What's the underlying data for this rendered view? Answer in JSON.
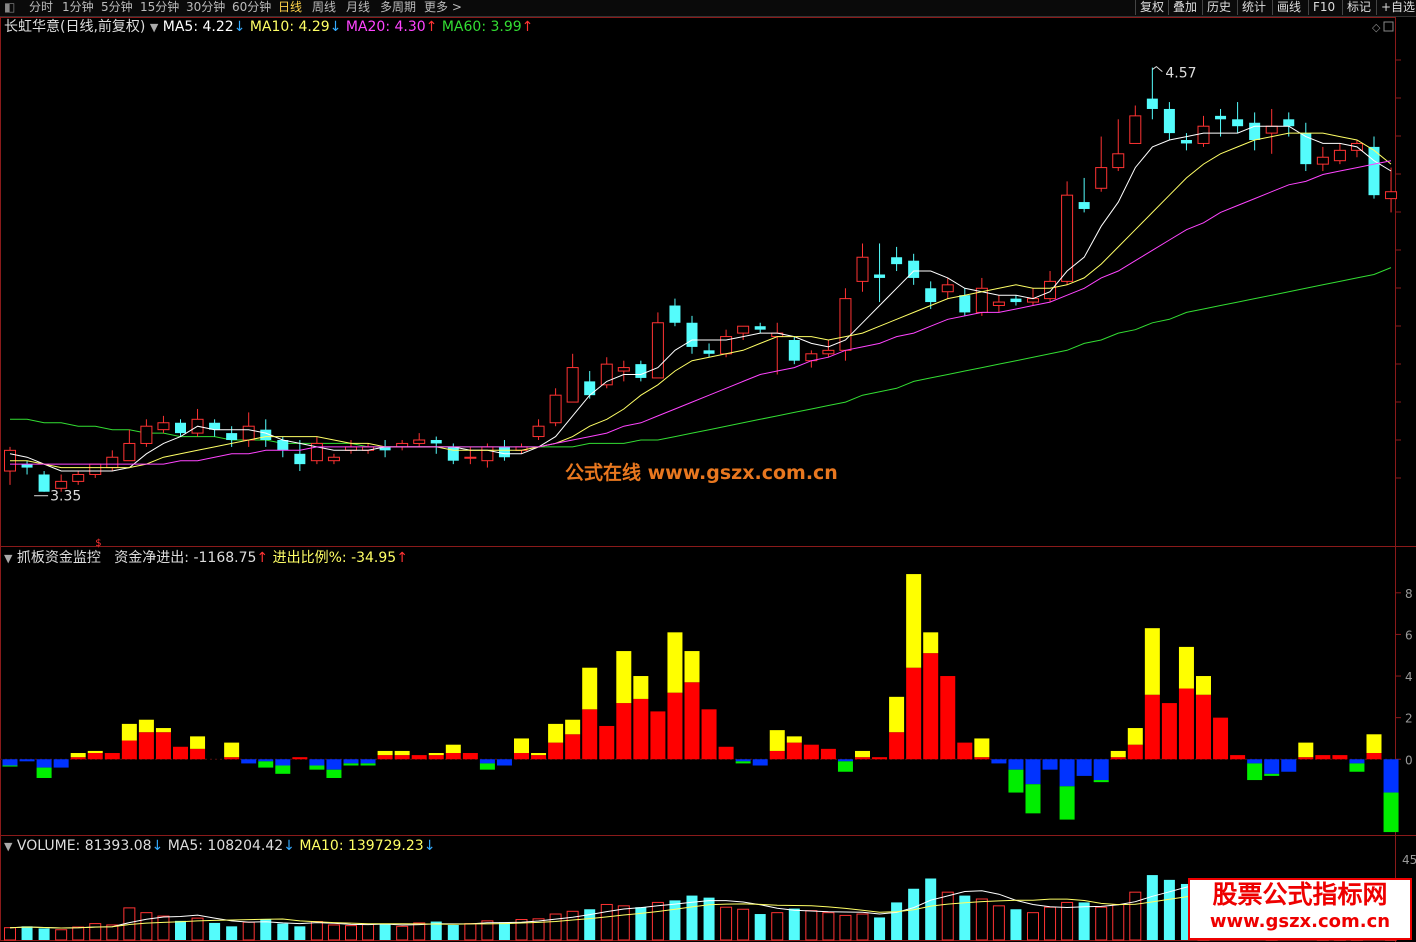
{
  "toolbar": {
    "periods": [
      "分时",
      "1分钟",
      "5分钟",
      "15分钟",
      "30分钟",
      "60分钟",
      "日线",
      "周线",
      "月线",
      "多周期",
      "更多 >"
    ],
    "active_period": "日线",
    "tools": [
      "复权",
      "叠加",
      "历史",
      "统计",
      "画线",
      "F10",
      "标记",
      "+自选"
    ]
  },
  "main_panel": {
    "stock_title": "长虹华意(日线,前复权)",
    "indicators": [
      {
        "label": "MA5: 4.22",
        "arrow": "↓",
        "color": "#ffffff"
      },
      {
        "label": "MA10: 4.29",
        "arrow": "↓",
        "color": "#ffff66"
      },
      {
        "label": "MA20: 4.30",
        "arrow": "↑",
        "color": "#ff44ff"
      },
      {
        "label": "MA60: 3.99",
        "arrow": "↑",
        "color": "#33dd33"
      }
    ],
    "high_label": "4.57",
    "low_label": "3.35",
    "watermark": "公式在线  www.gszx.com.cn"
  },
  "fund_panel": {
    "title": "抓板资金监控",
    "net_label": "资金净进出: -1168.75",
    "net_arrow": "↑",
    "ratio_label": "进出比例%: -34.95",
    "ratio_arrow": "↑",
    "y_ticks": [
      "8",
      "6",
      "4",
      "2",
      "0"
    ]
  },
  "volume_panel": {
    "label": "VOLUME: 81393.08",
    "label_arrow": "↓",
    "ma5": "MA5: 108204.42",
    "ma5_arrow": "↓",
    "ma10": "MA10: 139729.23",
    "ma10_arrow": "↓",
    "y_tick": "45"
  },
  "corner_watermark": {
    "line1": "股票公式指标网",
    "line2": "www.gszx.com.cn"
  },
  "colors": {
    "up": "#ff3333",
    "down": "#54fcfc",
    "ma5": "#ffffff",
    "ma10": "#ffff66",
    "ma20": "#ff44ff",
    "ma60": "#33dd33",
    "fund_red": "#ff0000",
    "fund_yellow": "#ffff00",
    "fund_blue": "#0033ff",
    "fund_green": "#00ee00"
  },
  "chart_data": {
    "type": "candlestick",
    "price_range": [
      3.2,
      4.65
    ],
    "candles": [
      [
        3.4,
        3.46,
        3.47,
        3.36
      ],
      [
        3.42,
        3.41,
        3.43,
        3.39
      ],
      [
        3.39,
        3.34,
        3.4,
        3.34
      ],
      [
        3.35,
        3.37,
        3.39,
        3.34
      ],
      [
        3.37,
        3.39,
        3.4,
        3.36
      ],
      [
        3.39,
        3.42,
        3.42,
        3.38
      ],
      [
        3.41,
        3.44,
        3.46,
        3.4
      ],
      [
        3.43,
        3.48,
        3.52,
        3.43
      ],
      [
        3.48,
        3.53,
        3.55,
        3.47
      ],
      [
        3.52,
        3.54,
        3.56,
        3.51
      ],
      [
        3.54,
        3.51,
        3.55,
        3.5
      ],
      [
        3.51,
        3.55,
        3.58,
        3.5
      ],
      [
        3.54,
        3.52,
        3.55,
        3.5
      ],
      [
        3.51,
        3.49,
        3.53,
        3.47
      ],
      [
        3.49,
        3.53,
        3.57,
        3.47
      ],
      [
        3.52,
        3.49,
        3.55,
        3.47
      ],
      [
        3.49,
        3.46,
        3.5,
        3.44
      ],
      [
        3.45,
        3.42,
        3.49,
        3.4
      ],
      [
        3.43,
        3.48,
        3.5,
        3.42
      ],
      [
        3.43,
        3.44,
        3.45,
        3.42
      ],
      [
        3.46,
        3.47,
        3.49,
        3.45
      ],
      [
        3.46,
        3.47,
        3.48,
        3.45
      ],
      [
        3.47,
        3.46,
        3.49,
        3.44
      ],
      [
        3.47,
        3.48,
        3.49,
        3.46
      ],
      [
        3.48,
        3.49,
        3.51,
        3.47
      ],
      [
        3.49,
        3.48,
        3.5,
        3.45
      ],
      [
        3.47,
        3.43,
        3.48,
        3.42
      ],
      [
        3.44,
        3.44,
        3.47,
        3.42
      ],
      [
        3.43,
        3.47,
        3.48,
        3.41
      ],
      [
        3.47,
        3.44,
        3.49,
        3.43
      ],
      [
        3.46,
        3.47,
        3.48,
        3.45
      ],
      [
        3.5,
        3.53,
        3.55,
        3.49
      ],
      [
        3.54,
        3.62,
        3.64,
        3.53
      ],
      [
        3.6,
        3.7,
        3.74,
        3.6
      ],
      [
        3.66,
        3.62,
        3.69,
        3.61
      ],
      [
        3.65,
        3.71,
        3.73,
        3.64
      ],
      [
        3.69,
        3.7,
        3.72,
        3.66
      ],
      [
        3.71,
        3.67,
        3.72,
        3.66
      ],
      [
        3.67,
        3.83,
        3.86,
        3.67
      ],
      [
        3.88,
        3.83,
        3.9,
        3.82
      ],
      [
        3.83,
        3.76,
        3.85,
        3.74
      ],
      [
        3.75,
        3.74,
        3.77,
        3.73
      ],
      [
        3.74,
        3.79,
        3.81,
        3.73
      ],
      [
        3.8,
        3.82,
        3.82,
        3.78
      ],
      [
        3.82,
        3.81,
        3.83,
        3.8
      ],
      [
        3.79,
        3.8,
        3.83,
        3.68
      ],
      [
        3.78,
        3.72,
        3.79,
        3.71
      ],
      [
        3.72,
        3.74,
        3.75,
        3.7
      ],
      [
        3.74,
        3.75,
        3.78,
        3.73
      ],
      [
        3.75,
        3.9,
        3.93,
        3.72
      ],
      [
        3.95,
        4.02,
        4.06,
        3.92
      ],
      [
        3.97,
        3.96,
        4.06,
        3.89
      ],
      [
        4.02,
        4.0,
        4.05,
        3.98
      ],
      [
        4.01,
        3.96,
        4.03,
        3.94
      ],
      [
        3.93,
        3.89,
        3.95,
        3.87
      ],
      [
        3.92,
        3.94,
        3.96,
        3.9
      ],
      [
        3.91,
        3.86,
        3.93,
        3.85
      ],
      [
        3.86,
        3.93,
        3.96,
        3.85
      ],
      [
        3.88,
        3.89,
        3.91,
        3.86
      ],
      [
        3.9,
        3.89,
        3.91,
        3.88
      ],
      [
        3.89,
        3.9,
        3.93,
        3.88
      ],
      [
        3.9,
        3.95,
        3.98,
        3.89
      ],
      [
        3.95,
        4.2,
        4.24,
        3.94
      ],
      [
        4.18,
        4.16,
        4.25,
        4.15
      ],
      [
        4.22,
        4.28,
        4.37,
        4.21
      ],
      [
        4.28,
        4.32,
        4.42,
        4.27
      ],
      [
        4.35,
        4.43,
        4.46,
        4.35
      ],
      [
        4.48,
        4.45,
        4.57,
        4.42
      ],
      [
        4.45,
        4.38,
        4.47,
        4.36
      ],
      [
        4.36,
        4.35,
        4.38,
        4.33
      ],
      [
        4.35,
        4.4,
        4.43,
        4.34
      ],
      [
        4.43,
        4.42,
        4.45,
        4.37
      ],
      [
        4.42,
        4.4,
        4.47,
        4.38
      ],
      [
        4.41,
        4.36,
        4.44,
        4.33
      ],
      [
        4.38,
        4.4,
        4.45,
        4.32
      ],
      [
        4.42,
        4.4,
        4.44,
        4.37
      ],
      [
        4.38,
        4.29,
        4.41,
        4.27
      ],
      [
        4.29,
        4.31,
        4.34,
        4.27
      ],
      [
        4.3,
        4.33,
        4.35,
        4.29
      ],
      [
        4.33,
        4.35,
        4.36,
        4.31
      ],
      [
        4.34,
        4.2,
        4.37,
        4.19
      ],
      [
        4.19,
        4.21,
        4.28,
        4.15
      ]
    ],
    "ma_series": [
      {
        "name": "MA5",
        "values": [
          3.45,
          3.44,
          3.42,
          3.4,
          3.4,
          3.4,
          3.4,
          3.41,
          3.45,
          3.48,
          3.5,
          3.53,
          3.52,
          3.52,
          3.52,
          3.51,
          3.49,
          3.48,
          3.47,
          3.46,
          3.46,
          3.46,
          3.47,
          3.47,
          3.47,
          3.47,
          3.47,
          3.46,
          3.46,
          3.45,
          3.45,
          3.47,
          3.5,
          3.56,
          3.62,
          3.66,
          3.68,
          3.68,
          3.7,
          3.75,
          3.78,
          3.78,
          3.78,
          3.79,
          3.8,
          3.8,
          3.79,
          3.77,
          3.76,
          3.78,
          3.83,
          3.88,
          3.93,
          3.98,
          3.98,
          3.96,
          3.93,
          3.92,
          3.91,
          3.91,
          3.9,
          3.92,
          3.98,
          4.02,
          4.11,
          4.18,
          4.28,
          4.34,
          4.36,
          4.37,
          4.38,
          4.38,
          4.38,
          4.4,
          4.4,
          4.4,
          4.37,
          4.35,
          4.35,
          4.34,
          4.3,
          4.27
        ]
      },
      {
        "name": "MA10",
        "values": [
          3.43,
          3.43,
          3.42,
          3.41,
          3.41,
          3.41,
          3.41,
          3.41,
          3.42,
          3.44,
          3.45,
          3.46,
          3.47,
          3.48,
          3.49,
          3.5,
          3.5,
          3.5,
          3.5,
          3.49,
          3.48,
          3.48,
          3.47,
          3.47,
          3.47,
          3.47,
          3.46,
          3.46,
          3.46,
          3.46,
          3.46,
          3.47,
          3.48,
          3.5,
          3.53,
          3.55,
          3.58,
          3.62,
          3.65,
          3.69,
          3.72,
          3.73,
          3.74,
          3.75,
          3.77,
          3.79,
          3.79,
          3.79,
          3.78,
          3.79,
          3.8,
          3.82,
          3.84,
          3.86,
          3.88,
          3.9,
          3.91,
          3.92,
          3.93,
          3.94,
          3.93,
          3.93,
          3.94,
          3.96,
          4.0,
          4.05,
          4.1,
          4.15,
          4.2,
          4.25,
          4.29,
          4.32,
          4.34,
          4.36,
          4.37,
          4.38,
          4.38,
          4.38,
          4.37,
          4.36,
          4.33,
          4.29
        ]
      },
      {
        "name": "MA20",
        "values": [
          3.42,
          3.42,
          3.42,
          3.42,
          3.42,
          3.42,
          3.42,
          3.42,
          3.42,
          3.42,
          3.43,
          3.43,
          3.44,
          3.45,
          3.45,
          3.46,
          3.46,
          3.46,
          3.47,
          3.47,
          3.47,
          3.47,
          3.47,
          3.47,
          3.47,
          3.47,
          3.47,
          3.47,
          3.47,
          3.47,
          3.47,
          3.47,
          3.48,
          3.49,
          3.5,
          3.51,
          3.53,
          3.54,
          3.56,
          3.58,
          3.6,
          3.62,
          3.64,
          3.66,
          3.68,
          3.69,
          3.7,
          3.72,
          3.73,
          3.75,
          3.76,
          3.77,
          3.79,
          3.8,
          3.82,
          3.84,
          3.85,
          3.86,
          3.86,
          3.87,
          3.88,
          3.89,
          3.91,
          3.93,
          3.96,
          3.98,
          4.01,
          4.04,
          4.07,
          4.1,
          4.12,
          4.15,
          4.17,
          4.19,
          4.21,
          4.23,
          4.24,
          4.26,
          4.27,
          4.28,
          4.29,
          4.3
        ]
      },
      {
        "name": "MA60",
        "values": [
          3.55,
          3.55,
          3.54,
          3.54,
          3.53,
          3.53,
          3.52,
          3.52,
          3.51,
          3.51,
          3.5,
          3.5,
          3.5,
          3.49,
          3.49,
          3.49,
          3.48,
          3.48,
          3.48,
          3.48,
          3.48,
          3.47,
          3.47,
          3.47,
          3.47,
          3.47,
          3.47,
          3.47,
          3.47,
          3.47,
          3.47,
          3.47,
          3.47,
          3.47,
          3.48,
          3.48,
          3.48,
          3.49,
          3.49,
          3.5,
          3.51,
          3.52,
          3.53,
          3.54,
          3.55,
          3.56,
          3.57,
          3.58,
          3.59,
          3.6,
          3.62,
          3.63,
          3.64,
          3.66,
          3.67,
          3.68,
          3.69,
          3.7,
          3.71,
          3.72,
          3.73,
          3.74,
          3.75,
          3.77,
          3.78,
          3.8,
          3.81,
          3.83,
          3.84,
          3.86,
          3.87,
          3.88,
          3.89,
          3.9,
          3.91,
          3.92,
          3.93,
          3.94,
          3.95,
          3.96,
          3.97,
          3.99
        ]
      }
    ],
    "fund_bars": [
      {
        "main": -0.3,
        "ext": -0.05
      },
      {
        "main": -0.1,
        "ext": 0
      },
      {
        "main": -0.4,
        "ext": -0.5
      },
      {
        "main": -0.4,
        "ext": 0
      },
      {
        "main": 0.1,
        "ext": 0.2
      },
      {
        "main": 0.3,
        "ext": 0.1
      },
      {
        "main": 0.3,
        "ext": 0
      },
      {
        "main": 0.9,
        "ext": 0.8
      },
      {
        "main": 1.3,
        "ext": 0.6
      },
      {
        "main": 1.3,
        "ext": 0.2
      },
      {
        "main": 0.6,
        "ext": 0
      },
      {
        "main": 0.5,
        "ext": 0.6
      },
      {
        "main": 0,
        "ext": 0
      },
      {
        "main": 0.1,
        "ext": 0.7
      },
      {
        "main": -0.2,
        "ext": 0
      },
      {
        "main": -0.1,
        "ext": -0.3
      },
      {
        "main": -0.3,
        "ext": -0.4
      },
      {
        "main": 0.1,
        "ext": 0
      },
      {
        "main": -0.3,
        "ext": -0.2
      },
      {
        "main": -0.5,
        "ext": -0.4
      },
      {
        "main": -0.2,
        "ext": -0.1
      },
      {
        "main": -0.2,
        "ext": -0.1
      },
      {
        "main": 0.2,
        "ext": 0.2
      },
      {
        "main": 0.2,
        "ext": 0.2
      },
      {
        "main": 0.2,
        "ext": 0
      },
      {
        "main": 0.2,
        "ext": 0.1
      },
      {
        "main": 0.3,
        "ext": 0.4
      },
      {
        "main": 0.3,
        "ext": 0
      },
      {
        "main": -0.2,
        "ext": -0.3
      },
      {
        "main": -0.3,
        "ext": 0
      },
      {
        "main": 0.3,
        "ext": 0.7
      },
      {
        "main": 0.2,
        "ext": 0.1
      },
      {
        "main": 0.8,
        "ext": 0.9
      },
      {
        "main": 1.2,
        "ext": 0.7
      },
      {
        "main": 2.4,
        "ext": 2.0
      },
      {
        "main": 1.6,
        "ext": 0
      },
      {
        "main": 2.7,
        "ext": 2.5
      },
      {
        "main": 2.9,
        "ext": 1.1
      },
      {
        "main": 2.3,
        "ext": 0
      },
      {
        "main": 3.2,
        "ext": 2.9
      },
      {
        "main": 3.7,
        "ext": 1.5
      },
      {
        "main": 2.4,
        "ext": 0
      },
      {
        "main": 0.6,
        "ext": 0
      },
      {
        "main": -0.1,
        "ext": -0.1
      },
      {
        "main": -0.3,
        "ext": 0
      },
      {
        "main": 0.4,
        "ext": 1.0
      },
      {
        "main": 0.8,
        "ext": 0.3
      },
      {
        "main": 0.7,
        "ext": 0
      },
      {
        "main": 0.5,
        "ext": 0
      },
      {
        "main": -0.1,
        "ext": -0.5
      },
      {
        "main": 0.1,
        "ext": 0.3
      },
      {
        "main": 0.1,
        "ext": 0
      },
      {
        "main": 1.3,
        "ext": 1.7
      },
      {
        "main": 4.4,
        "ext": 4.5
      },
      {
        "main": 5.1,
        "ext": 1.0
      },
      {
        "main": 4.0,
        "ext": 0
      },
      {
        "main": 0.8,
        "ext": 0
      },
      {
        "main": 0.1,
        "ext": 0.9
      },
      {
        "main": -0.2,
        "ext": 0
      },
      {
        "main": -0.5,
        "ext": -1.1
      },
      {
        "main": -1.2,
        "ext": -1.4
      },
      {
        "main": -0.5,
        "ext": 0.5
      },
      {
        "main": -1.3,
        "ext": -1.6
      },
      {
        "main": -0.8,
        "ext": 0
      },
      {
        "main": -1.0,
        "ext": -0.1
      },
      {
        "main": 0.1,
        "ext": 0.3
      },
      {
        "main": 0.7,
        "ext": 0.8
      },
      {
        "main": 3.1,
        "ext": 3.2
      },
      {
        "main": 2.7,
        "ext": 0
      },
      {
        "main": 3.4,
        "ext": 2.0
      },
      {
        "main": 3.1,
        "ext": 0.9
      },
      {
        "main": 2.0,
        "ext": 0
      },
      {
        "main": 0.2,
        "ext": 0
      },
      {
        "main": -0.2,
        "ext": -0.8
      },
      {
        "main": -0.7,
        "ext": -0.1
      },
      {
        "main": -0.6,
        "ext": 0
      },
      {
        "main": 0.1,
        "ext": 0.7
      },
      {
        "main": 0.2,
        "ext": 0
      },
      {
        "main": 0.2,
        "ext": 0
      },
      {
        "main": -0.2,
        "ext": -0.4
      },
      {
        "main": 0.3,
        "ext": 0.9
      },
      {
        "main": -1.6,
        "ext": -1.9
      }
    ],
    "fund_range": [
      -3.4,
      9.0
    ],
    "volume_bars": [
      18,
      20,
      17,
      15,
      19,
      24,
      22,
      47,
      40,
      35,
      28,
      32,
      25,
      20,
      26,
      30,
      24,
      20,
      27,
      22,
      21,
      23,
      24,
      20,
      25,
      27,
      22,
      24,
      28,
      26,
      30,
      31,
      38,
      42,
      45,
      52,
      50,
      48,
      55,
      58,
      65,
      62,
      48,
      45,
      38,
      40,
      46,
      43,
      40,
      36,
      38,
      33,
      55,
      75,
      90,
      70,
      65,
      60,
      50,
      45,
      40,
      48,
      55,
      55,
      48,
      52,
      70,
      95,
      88,
      82,
      78,
      90,
      85,
      80,
      75,
      72,
      66,
      60,
      55,
      52,
      55,
      58
    ],
    "volume_range": [
      0,
      120
    ]
  }
}
